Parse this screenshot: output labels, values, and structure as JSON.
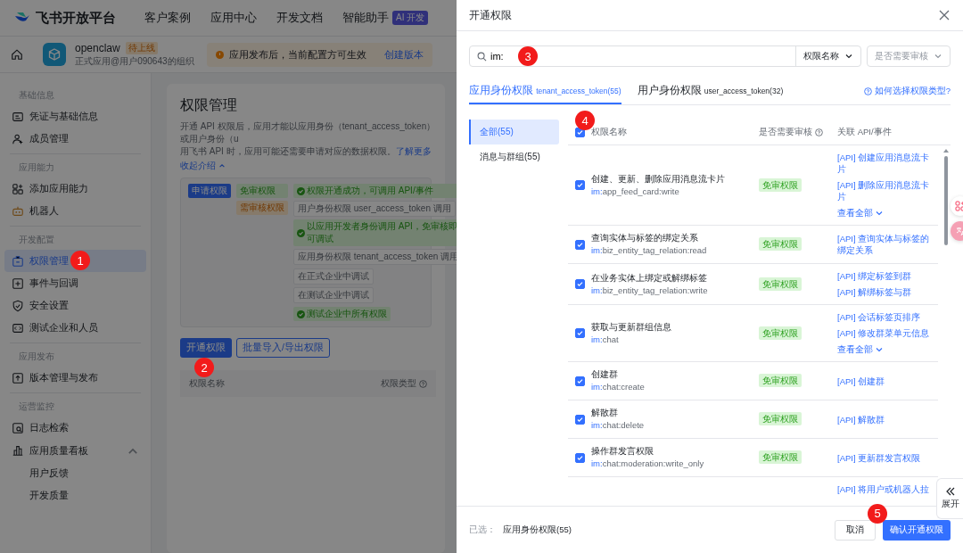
{
  "nav": {
    "brand": "飞书开放平台",
    "items": [
      "客户案例",
      "应用中心",
      "开发文档",
      "智能助手"
    ],
    "ai_badge": "AI 开发"
  },
  "app_bar": {
    "name": "openclaw",
    "status": "待上线",
    "org": "正式应用@用户090643的组织",
    "notice": "应用发布后，当前配置方可生效",
    "notice_link": "创建版本"
  },
  "sidebar": {
    "groups": [
      {
        "title": "基础信息",
        "items": [
          {
            "label": "凭证与基础信息",
            "selected": false
          },
          {
            "label": "成员管理",
            "selected": false
          }
        ]
      },
      {
        "title": "应用能力",
        "items": [
          {
            "label": "添加应用能力",
            "selected": false
          },
          {
            "label": "机器人",
            "selected": false
          }
        ]
      },
      {
        "title": "开发配置",
        "items": [
          {
            "label": "权限管理",
            "selected": true,
            "badge": "1"
          },
          {
            "label": "事件与回调",
            "selected": false
          },
          {
            "label": "安全设置",
            "selected": false
          },
          {
            "label": "测试企业和人员",
            "selected": false
          }
        ]
      },
      {
        "title": "应用发布",
        "items": [
          {
            "label": "版本管理与发布",
            "selected": false
          }
        ]
      },
      {
        "title": "运营监控",
        "items": [
          {
            "label": "日志检索",
            "selected": false
          },
          {
            "label": "应用质量看板",
            "selected": false,
            "expanded": true,
            "children": [
              {
                "label": "用户反馈",
                "selected": false
              },
              {
                "label": "开发质量",
                "selected": false
              }
            ]
          }
        ]
      }
    ]
  },
  "main": {
    "title": "权限管理",
    "description": "开通 API 权限后，应用才能以应用身份（tenant_access_token）或用户身份（u",
    "description_2": "用飞书 API 时，应用可能还需要申请对应的数据权限。",
    "learn_more": "了解更多",
    "collapse": "收起介绍",
    "diagram": {
      "start": "申请权限",
      "free": "免审权限",
      "free_result": "权限开通成功，可调用 API/事件",
      "review": "需审核权限",
      "user_node": "用户身份权限",
      "user_token": "user_access_token 调用",
      "user_result": "以应用开发者身份调用 API，免审核即可调试",
      "tenant_node": "应用身份权限",
      "tenant_token": "tenant_access_token 调用",
      "formal": "在正式企业中调试",
      "test": "在测试企业中调试",
      "test_result": "测试企业中所有权限"
    },
    "open_button": {
      "label": "开通权限",
      "badge": "2"
    },
    "import_button": "批量导入/导出权限",
    "columns": [
      "权限名称",
      "权限类型"
    ]
  },
  "drawer": {
    "title": "开通权限",
    "search": {
      "value": "im:",
      "badge": "3"
    },
    "field_select": "权限名称",
    "review_select": {
      "placeholder": "是否需要审核"
    },
    "tabs": [
      {
        "label": "应用身份权限",
        "token": "tenant_access_token(55)",
        "selected": true
      },
      {
        "label": "用户身份权限",
        "token": "user_access_token(32)",
        "selected": false
      }
    ],
    "help_link": "如何选择权限类型?",
    "categories": [
      {
        "label": "全部(55)",
        "selected": true
      },
      {
        "label": "消息与群组(55)",
        "selected": false
      }
    ],
    "table": {
      "all_checked": true,
      "badge": "4",
      "columns": [
        "权限名称",
        "是否需要审核",
        "关联 API/事件"
      ],
      "rows": [
        {
          "checked": true,
          "name": "创建、更新、删除应用消息流卡片",
          "scope": "im:app_feed_card:write",
          "review": "免审权限",
          "apis": [
            "[API] 创建应用消息流卡片",
            "[API] 删除应用消息流卡片"
          ],
          "more": "查看全部"
        },
        {
          "checked": true,
          "name": "查询实体与标签的绑定关系",
          "scope": "im:biz_entity_tag_relation:read",
          "review": "免审权限",
          "apis": [
            "[API] 查询实体与标签的绑定关系"
          ]
        },
        {
          "checked": true,
          "name": "在业务实体上绑定或解绑标签",
          "scope": "im:biz_entity_tag_relation:write",
          "review": "免审权限",
          "apis": [
            "[API] 绑定标签到群",
            "[API] 解绑标签与群"
          ]
        },
        {
          "checked": true,
          "name": "获取与更新群组信息",
          "scope": "im:chat",
          "review": "免审权限",
          "apis": [
            "[API] 会话标签页排序",
            "[API] 修改群菜单元信息"
          ],
          "more": "查看全部"
        },
        {
          "checked": true,
          "name": "创建群",
          "scope": "im:chat:create",
          "review": "免审权限",
          "apis": [
            "[API] 创建群"
          ]
        },
        {
          "checked": true,
          "name": "解散群",
          "scope": "im:chat:delete",
          "review": "免审权限",
          "apis": [
            "[API] 解散群"
          ]
        },
        {
          "checked": true,
          "name": "操作群发言权限",
          "scope": "im:chat:moderation:write_only",
          "review": "免审权限",
          "apis": [
            "[API] 更新群发言权限"
          ]
        },
        {
          "apis": [
            "[API] 将用户或机器人拉"
          ]
        }
      ]
    },
    "footer": {
      "selected_label": "已选：",
      "selected_value": "应用身份权限(55)",
      "cancel": "取消",
      "confirm": {
        "label": "确认开通权限",
        "badge": "5"
      }
    },
    "expand_button": "展开"
  }
}
